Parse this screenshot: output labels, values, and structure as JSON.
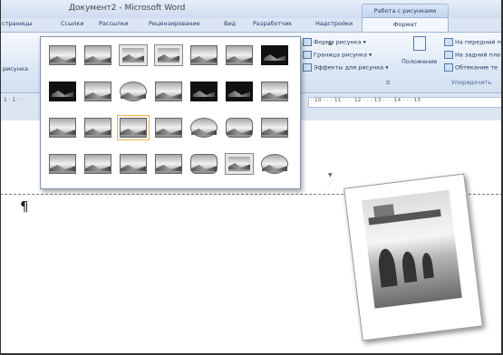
{
  "window": {
    "title": "Документ2 - Microsoft Word",
    "context_tools": "Работа с рисунками"
  },
  "tabs": [
    "страницы",
    "Ссылки",
    "Рассылки",
    "Рецензирование",
    "Вид",
    "Разработчик",
    "Надстройки"
  ],
  "active_tab": "Формат",
  "ribbon": {
    "left_label": "рисунка",
    "picture_styles": {
      "format": "Форма рисунка",
      "border": "Граница рисунка",
      "effects": "Эффекты для рисунка"
    },
    "arrange": {
      "position": "Положение",
      "bring_front": "На передний п",
      "send_back": "На задний пла",
      "wrap": "Обтекание те",
      "group_label": "Упорядочить"
    }
  },
  "ruler": {
    "numbers": "· 10 · · · 11 · · · 12 · · · 13 · · · 14 · · · 15",
    "left": "1 · 1 · ·"
  },
  "document": {
    "paragraph_mark": "¶"
  },
  "gallery": {
    "rows": 4,
    "columns": 7,
    "selected_index": 16
  }
}
